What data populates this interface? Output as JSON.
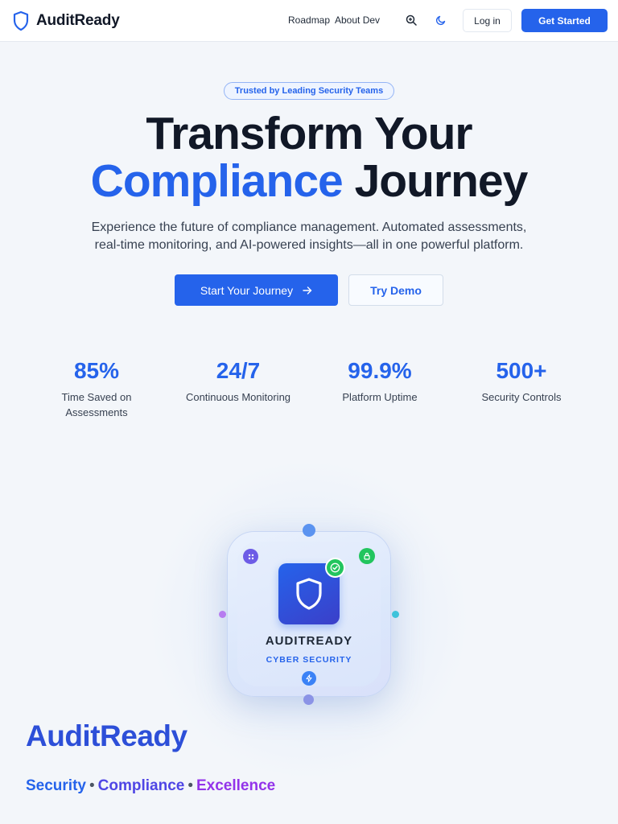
{
  "header": {
    "brand_name": "AuditReady",
    "nav": [
      "Roadmap",
      "About Dev"
    ],
    "login_label": "Log in",
    "get_started_label": "Get Started"
  },
  "hero": {
    "badge": "Trusted by Leading Security Teams",
    "headline_line1": "Transform Your",
    "headline_highlight": "Compliance",
    "headline_rest": "Journey",
    "subtext_line1": "Experience the future of compliance management. Automated assessments,",
    "subtext_line2": "real-time monitoring, and AI-powered insights—all in one powerful platform.",
    "primary_cta": "Start Your Journey",
    "secondary_cta": "Try Demo"
  },
  "stats": [
    {
      "value": "85%",
      "label_line1": "Time Saved on",
      "label_line2": "Assessments"
    },
    {
      "value": "24/7",
      "label_line1": "Continuous Monitoring",
      "label_line2": ""
    },
    {
      "value": "99.9%",
      "label_line1": "Platform Uptime",
      "label_line2": ""
    },
    {
      "value": "500+",
      "label_line1": "Security Controls",
      "label_line2": ""
    }
  ],
  "visual": {
    "title": "AUDITREADY",
    "subtitle": "CYBER SECURITY"
  },
  "footer_brand": {
    "name": "AuditReady",
    "tag1": "Security",
    "tag2": "Compliance",
    "tag3": "Excellence",
    "separator": "•"
  },
  "colors": {
    "primary": "#2563eb",
    "indigo": "#4f46e5",
    "purple": "#9333ea",
    "green": "#22c55e"
  },
  "icons": [
    "shield-icon",
    "zoom-icon",
    "moon-icon",
    "arrow-right-icon",
    "check-icon",
    "lock-icon",
    "sparkle-icon",
    "bolt-icon"
  ]
}
